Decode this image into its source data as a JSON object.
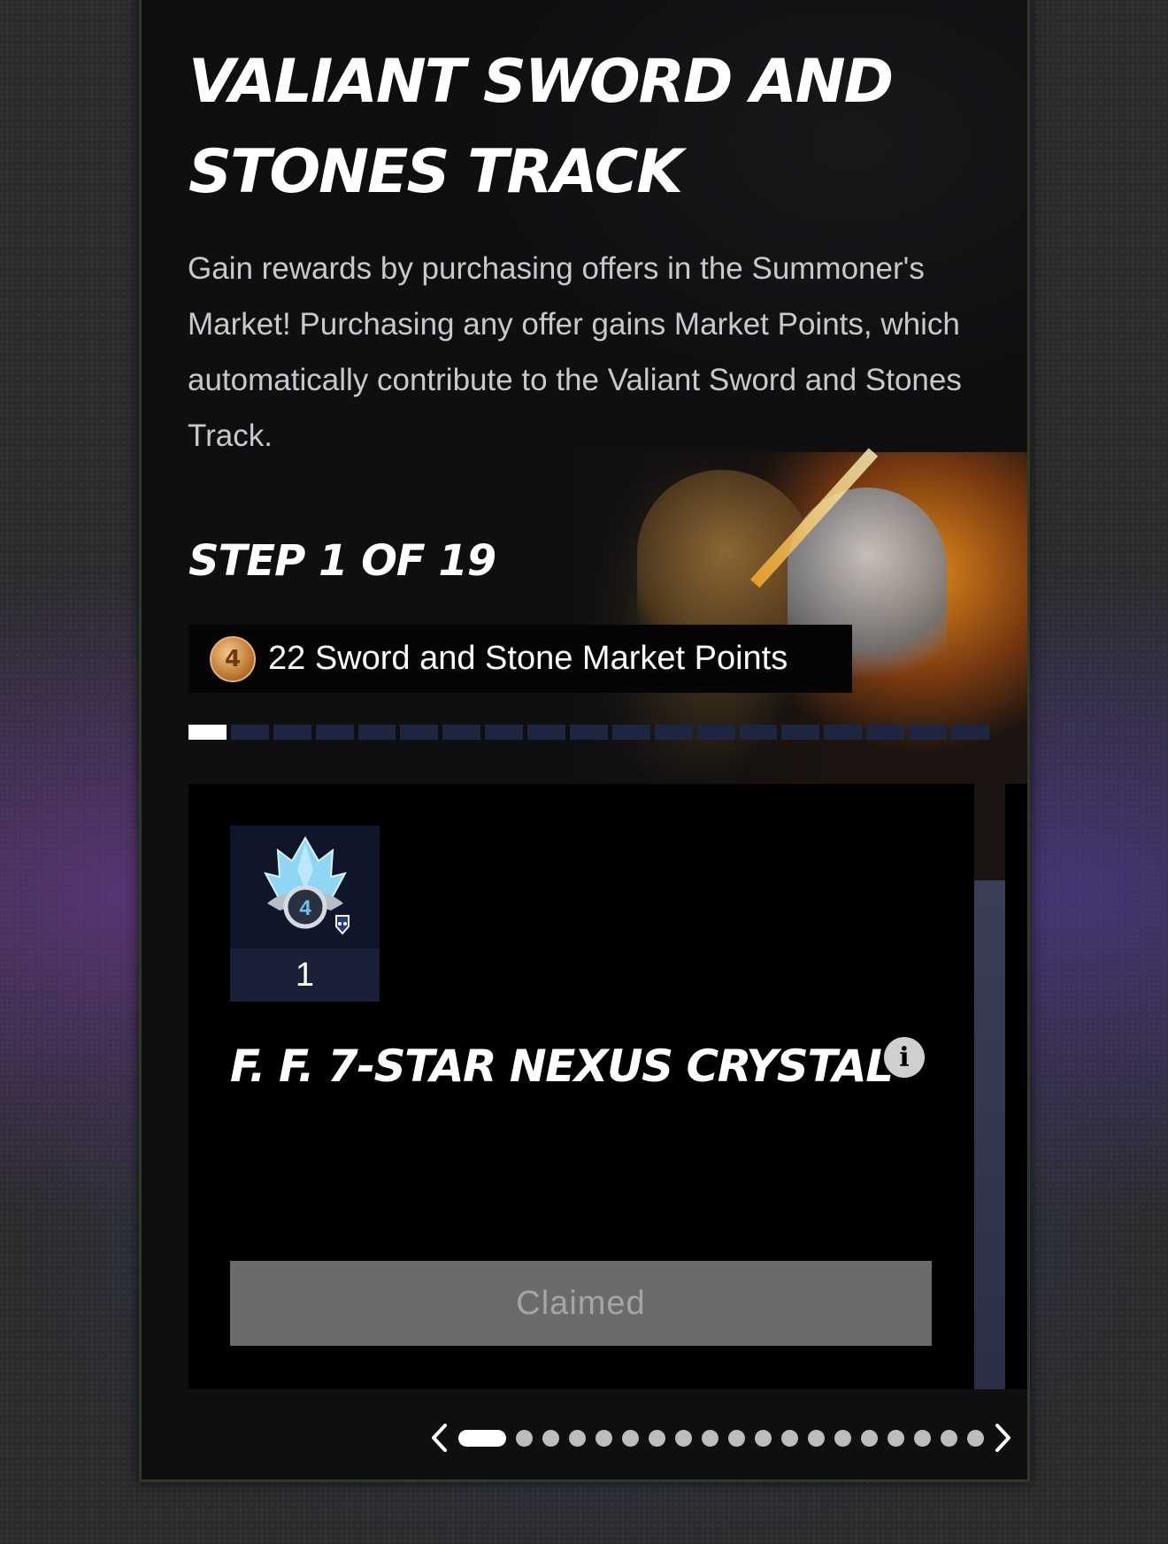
{
  "card": {
    "title": "VALIANT SWORD AND STONES TRACK",
    "description": "Gain rewards by purchasing offers in the Summoner's Market! Purchasing any offer gains Market Points, which automatically contribute to the Valiant Sword and Stones Track."
  },
  "track": {
    "step_label": "STEP 1 OF 19",
    "current_step": 1,
    "total_steps": 19,
    "points_text": "22 Sword and Stone Market Points",
    "points_icon": "fantastic-four-coin-icon"
  },
  "reward": {
    "quantity": "1",
    "name": "F. F. 7-STAR NEXUS CRYSTAL",
    "icon": "nexus-crystal-icon",
    "info_icon": "info-icon",
    "button_label": "Claimed",
    "button_state": "disabled"
  },
  "pager": {
    "total_pages": 19,
    "active_page": 1,
    "prev_icon": "chevron-left-icon",
    "next_icon": "chevron-right-icon"
  },
  "colors": {
    "card_background": "#0f0f12",
    "progress_active": "#ffffff",
    "progress_inactive": "#1e2540",
    "button_disabled": "#6b6b6b"
  }
}
